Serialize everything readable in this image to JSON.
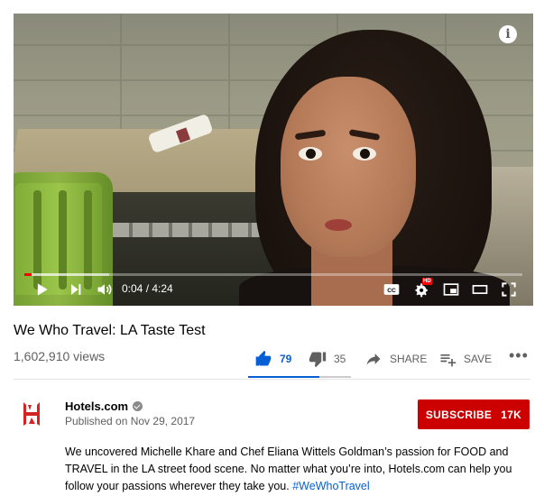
{
  "player": {
    "current_time": "0:04",
    "duration": "4:24",
    "time_separator": " / ",
    "played_fraction": 0.015,
    "loaded_fraction": 0.17,
    "hd_badge": "HD",
    "info_glyph": "i"
  },
  "video": {
    "title": "We Who Travel: LA Taste Test",
    "views": "1,602,910 views",
    "likes": "79",
    "dislikes": "35",
    "share_label": "SHARE",
    "save_label": "SAVE",
    "more_label": "•••",
    "like_ratio": 0.69
  },
  "channel": {
    "name": "Hotels.com",
    "published": "Published on Nov 29, 2017",
    "subscribe_label": "SUBSCRIBE",
    "subscriber_count": "17K"
  },
  "description": {
    "text": "We uncovered Michelle Khare and Chef Eliana Wittels Goldman’s passion for FOOD and TRAVEL in the LA street food scene. No matter what you’re into, Hotels.com can help you follow your passions wherever they take you. ",
    "hashtag": "#WeWhoTravel"
  },
  "colors": {
    "accent_blue": "#065fd4",
    "subscribe_red": "#cc0000",
    "progress_red": "#ff0000",
    "brand_red": "#d32323"
  },
  "icons": {
    "play": "play-icon",
    "next": "next-icon",
    "volume": "volume-icon",
    "captions": "captions-icon",
    "settings": "settings-icon",
    "miniplayer": "miniplayer-icon",
    "theater": "theater-mode-icon",
    "fullscreen": "fullscreen-icon",
    "like": "thumbs-up-icon",
    "dislike": "thumbs-down-icon",
    "share": "share-icon",
    "save": "playlist-add-icon",
    "verified": "verified-check-icon",
    "info": "info-icon"
  }
}
